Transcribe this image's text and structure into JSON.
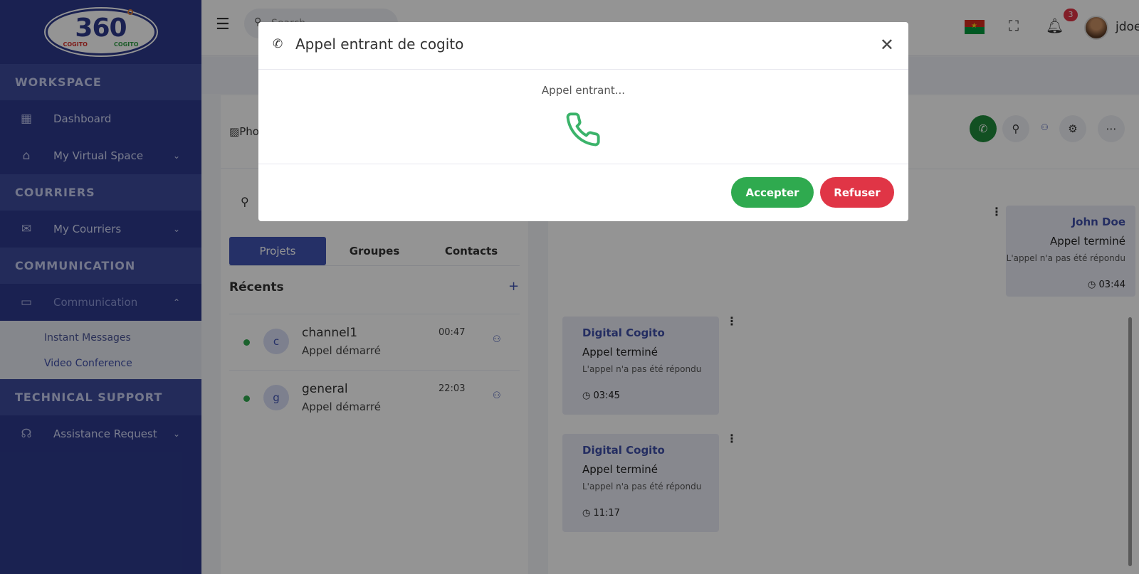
{
  "brand": {
    "logo_number": "360",
    "logo_left": "COGITO",
    "logo_right": "COGITO"
  },
  "sidebar": {
    "sections": [
      {
        "label": "WORKSPACE"
      },
      {
        "label": "COURRIERS"
      },
      {
        "label": "COMMUNICATION"
      },
      {
        "label": "TECHNICAL SUPPORT"
      }
    ],
    "items": {
      "dashboard": "Dashboard",
      "virtual_space": "My Virtual Space",
      "courriers": "My Courriers",
      "communication": "Communication",
      "assistance": "Assistance Request"
    },
    "submenu": [
      "Instant Messages",
      "Video Conference"
    ]
  },
  "topbar": {
    "search_placeholder": "Search",
    "notifications": "3",
    "username": "jdoe"
  },
  "chatlist": {
    "header_img_alt": "Pho",
    "tabs": [
      "Projets",
      "Groupes",
      "Contacts"
    ],
    "recent_title": "Récents",
    "add": "+",
    "conversations": [
      {
        "initial": "c",
        "name": "channel1",
        "last": "Appel démarré",
        "time": "00:47"
      },
      {
        "initial": "g",
        "name": "general",
        "last": "Appel démarré",
        "time": "22:03"
      }
    ]
  },
  "messages": [
    {
      "author": "John Doe",
      "text": "Appel terminé",
      "sub": "L'appel n'a pas été répondu",
      "time": "03:44"
    },
    {
      "author": "Digital Cogito",
      "text": "Appel terminé",
      "sub": "L'appel n'a pas été répondu",
      "time": "03:45"
    },
    {
      "author": "Digital Cogito",
      "text": "Appel terminé",
      "sub": "L'appel n'a pas été répondu",
      "time": "11:17"
    }
  ],
  "modal": {
    "title": "Appel entrant de cogito",
    "status": "Appel entrant...",
    "accept": "Accepter",
    "refuse": "Refuser"
  },
  "colors": {
    "sidebar": "#2d3a8c",
    "accent": "#4054b2",
    "accept": "#2faa4f",
    "refuse": "#e03546"
  }
}
